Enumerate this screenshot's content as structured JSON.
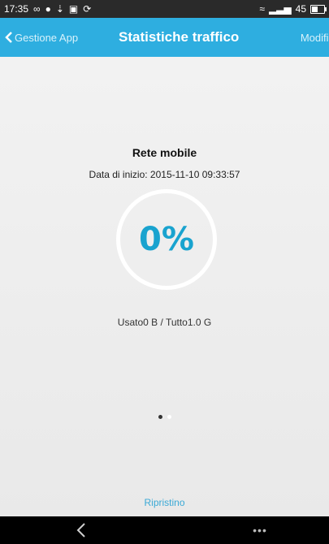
{
  "status_bar": {
    "time": "17:35",
    "battery": "45"
  },
  "app_bar": {
    "back_label": "Gestione App",
    "title": "Statistiche traffico",
    "edit_label": "Modific"
  },
  "traffic": {
    "network_label": "Rete mobile",
    "start_date": "Data di inizio: 2015-11-10 09:33:57",
    "percent": "0%",
    "usage": "Usato0 B / Tutto1.0 G"
  },
  "pager": {
    "pages": 2,
    "active_page": 1
  },
  "actions": {
    "reset_label": "Ripristino"
  },
  "colors": {
    "accent": "#2eaee0",
    "percent_text": "#19a3cf",
    "link": "#3aa9d6"
  },
  "nav_bar": {
    "more_label": "•••"
  }
}
